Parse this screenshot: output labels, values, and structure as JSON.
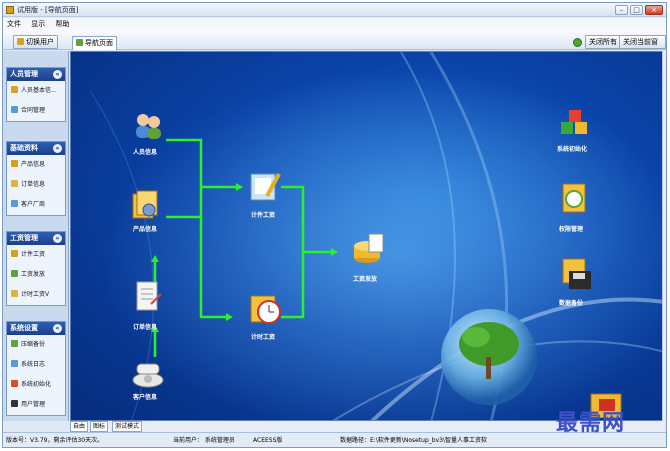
{
  "window": {
    "title": "试用版 - [导航页面]"
  },
  "menu": [
    "文件",
    "显示",
    "帮助"
  ],
  "toolbar": {
    "switch_user": "切换用户",
    "nav_tab": "导航页面",
    "close_all": "关闭所有",
    "close_current": "关闭当前窗口"
  },
  "sidebar": {
    "groups": [
      {
        "title": "人员管理",
        "items": [
          "人员基本信...",
          "合同管理"
        ]
      },
      {
        "title": "基础资料",
        "items": [
          "产品信息",
          "订单信息",
          "客户厂商"
        ]
      },
      {
        "title": "工资管理",
        "items": [
          "计件工资",
          "工资发放",
          "计时工资V"
        ]
      },
      {
        "title": "系统设置",
        "items": [
          "压缩备份",
          "系统日志",
          "系统初始化",
          "用户管理"
        ]
      }
    ]
  },
  "nodes": {
    "personnel": "人员信息",
    "product": "产品信息",
    "order": "订单信息",
    "customer": "客户信息",
    "piecework": "计件工资",
    "timework": "计时工资",
    "summary": "工资发放",
    "init": "系统初始化",
    "perms": "权限管理",
    "backup": "数据备份"
  },
  "bottom_tabs": [
    "自由",
    "图标",
    "测试模式"
  ],
  "status": {
    "version": "版本号：V3.79，剩余评估30天次。",
    "user": "当前用户： 系统管理员",
    "db": "ACEESS版",
    "path": "数据路径：E:\\软件更新\\Nosetup_bv3\\智量人事工资软"
  },
  "watermark": "最需网"
}
